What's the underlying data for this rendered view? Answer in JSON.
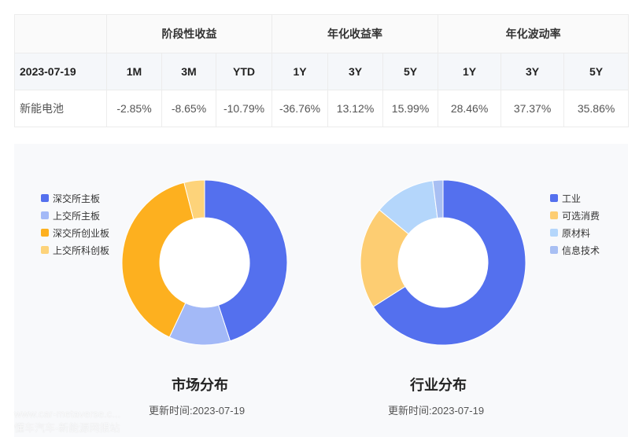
{
  "table": {
    "group_headers": [
      "阶段性收益",
      "年化收益率",
      "年化波动率"
    ],
    "date": "2023-07-19",
    "sub_headers": [
      "1M",
      "3M",
      "YTD",
      "1Y",
      "3Y",
      "5Y",
      "1Y",
      "3Y",
      "5Y"
    ],
    "row_name": "新能电池",
    "values": [
      "-2.85%",
      "-8.65%",
      "-10.79%",
      "-36.76%",
      "13.12%",
      "15.99%",
      "28.46%",
      "37.37%",
      "35.86%"
    ]
  },
  "chart_data": [
    {
      "type": "pie",
      "title": "市场分布",
      "updated_label": "更新时间:",
      "updated_date": "2023-07-19",
      "legend_position": "left",
      "categories": [
        "深交所主板",
        "上交所主板",
        "深交所创业板",
        "上交所科创板"
      ],
      "values": [
        45,
        12,
        39,
        4
      ],
      "colors": [
        "#5470ee",
        "#a3b9f7",
        "#fdb01f",
        "#fdd37a"
      ]
    },
    {
      "type": "pie",
      "title": "行业分布",
      "updated_label": "更新时间:",
      "updated_date": "2023-07-19",
      "legend_position": "right",
      "categories": [
        "工业",
        "可选消费",
        "原材料",
        "信息技术"
      ],
      "values": [
        66,
        20,
        12,
        2
      ],
      "colors": [
        "#5470ee",
        "#fdcd72",
        "#b4d6fb",
        "#a8bff3"
      ]
    }
  ],
  "watermark": {
    "line1": "www.car-metaverse.c...",
    "line2": "懂车汽车-新能源网报站"
  }
}
